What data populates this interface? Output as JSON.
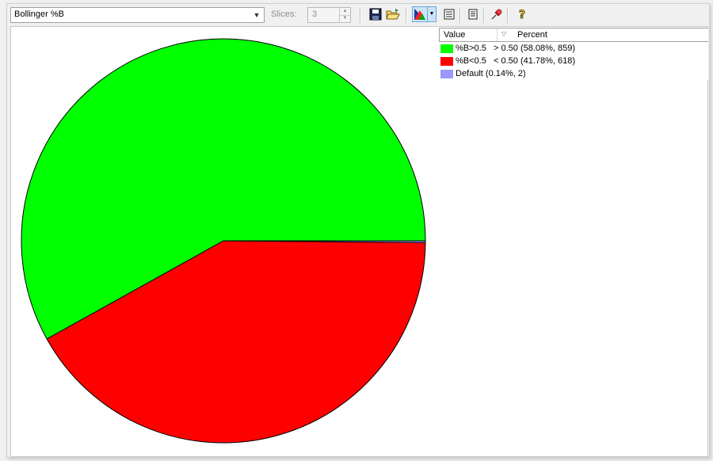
{
  "toolbar": {
    "indicator_select": "Bollinger %B",
    "slices_label": "Slices:",
    "slices_value": "3",
    "icons": [
      "save-icon",
      "open-folder-icon",
      "pie-chart-icon",
      "dropdown-arrow-icon",
      "table-icon",
      "list-icon",
      "pin-icon",
      "help-icon"
    ]
  },
  "legend": {
    "col_value": "Value",
    "col_percent": "Percent",
    "rows": [
      {
        "label": "%B>0.5",
        "detail": "> 0.50 (58.08%, 859)",
        "color": "#00ff00"
      },
      {
        "label": "%B<0.5",
        "detail": "< 0.50 (41.78%, 618)",
        "color": "#ff0000"
      },
      {
        "label": "Default (0.14%, 2)",
        "detail": "",
        "color": "#9999ff"
      }
    ]
  },
  "chart_data": {
    "type": "pie",
    "title": "",
    "slices": [
      {
        "name": "%B>0.5",
        "percent": 58.08,
        "count": 859,
        "color": "#00ff00"
      },
      {
        "name": "%B<0.5",
        "percent": 41.78,
        "count": 618,
        "color": "#ff0000"
      },
      {
        "name": "Default",
        "percent": 0.14,
        "count": 2,
        "color": "#9999ff"
      }
    ],
    "legend_placement": "top-right"
  }
}
